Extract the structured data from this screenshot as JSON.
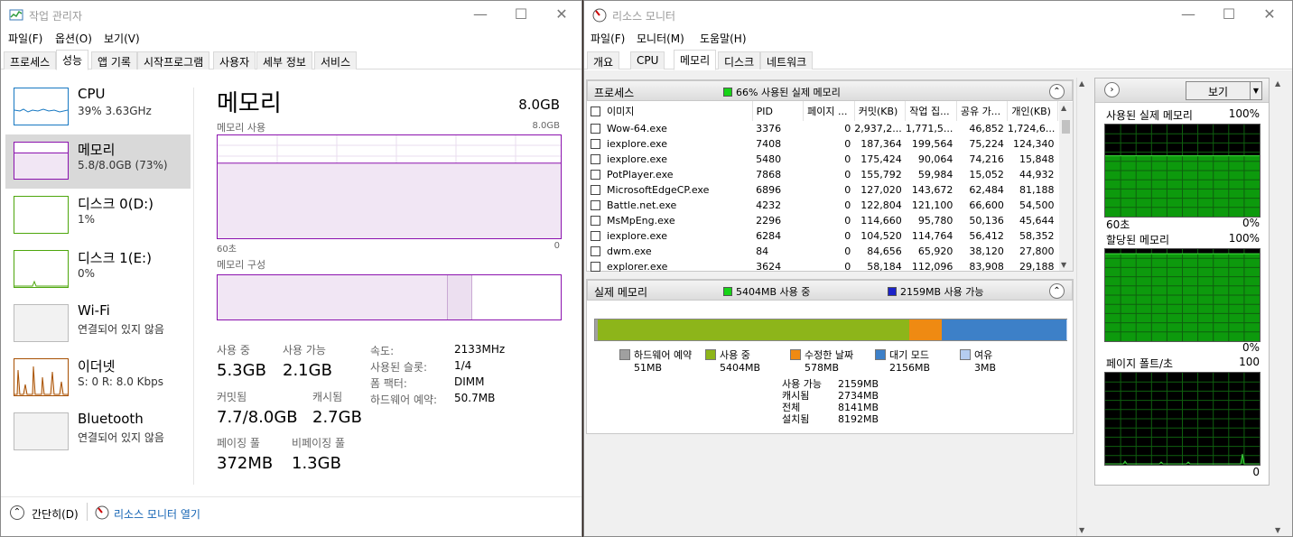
{
  "task_manager": {
    "title": "작업 관리자",
    "menu": [
      "파일(F)",
      "옵션(O)",
      "보기(V)"
    ],
    "tabs": [
      "프로세스",
      "성능",
      "앱 기록",
      "시작프로그램",
      "사용자",
      "세부 정보",
      "서비스"
    ],
    "active_tab": "성능",
    "left_items": [
      {
        "title": "CPU",
        "sub": "39% 3.63GHz"
      },
      {
        "title": "메모리",
        "sub": "5.8/8.0GB (73%)"
      },
      {
        "title": "디스크 0(D:)",
        "sub": "1%"
      },
      {
        "title": "디스크 1(E:)",
        "sub": "0%"
      },
      {
        "title": "Wi-Fi",
        "sub": "연결되어 있지 않음"
      },
      {
        "title": "이더넷",
        "sub": "S: 0  R: 8.0 Kbps"
      },
      {
        "title": "Bluetooth",
        "sub": "연결되어 있지 않음"
      }
    ],
    "memory": {
      "heading": "메모리",
      "total": "8.0GB",
      "usage_label": "메모리 사용",
      "usage_max": "8.0GB",
      "x_left": "60초",
      "x_right": "0",
      "composition_label": "메모리 구성",
      "used_pct": 0.73,
      "stats": [
        {
          "label": "사용 중",
          "value": "5.3GB"
        },
        {
          "label": "사용 가능",
          "value": "2.1GB"
        },
        {
          "label": "커밋됨",
          "value": "7.7/8.0GB"
        },
        {
          "label": "캐시됨",
          "value": "2.7GB"
        },
        {
          "label": "페이징 풀",
          "value": "372MB"
        },
        {
          "label": "비페이징 풀",
          "value": "1.3GB"
        }
      ],
      "specs": [
        {
          "label": "속도:",
          "value": "2133MHz"
        },
        {
          "label": "사용된 슬롯:",
          "value": "1/4"
        },
        {
          "label": "폼 팩터:",
          "value": "DIMM"
        },
        {
          "label": "하드웨어 예약:",
          "value": "50.7MB"
        }
      ]
    },
    "footer": {
      "fewer": "간단히(D)",
      "resmon": "리소스 모니터 열기"
    }
  },
  "resource_monitor": {
    "title": "리소스 모니터",
    "menu": [
      "파일(F)",
      "모니터(M)",
      "도움말(H)"
    ],
    "tabs": [
      "개요",
      "CPU",
      "메모리",
      "디스크",
      "네트워크"
    ],
    "active_tab": "메모리",
    "process_section": {
      "title": "프로세스",
      "meter": "66% 사용된 실제 메모리",
      "columns": [
        "이미지",
        "PID",
        "페이지 ...",
        "커밋(KB)",
        "작업 집...",
        "공유 가...",
        "개인(KB)"
      ],
      "rows": [
        [
          "Wow-64.exe",
          "3376",
          "0",
          "2,937,2...",
          "1,771,5...",
          "46,852",
          "1,724,6..."
        ],
        [
          "iexplore.exe",
          "7408",
          "0",
          "187,364",
          "199,564",
          "75,224",
          "124,340"
        ],
        [
          "iexplore.exe",
          "5480",
          "0",
          "175,424",
          "90,064",
          "74,216",
          "15,848"
        ],
        [
          "PotPlayer.exe",
          "7868",
          "0",
          "155,792",
          "59,984",
          "15,052",
          "44,932"
        ],
        [
          "MicrosoftEdgeCP.exe",
          "6896",
          "0",
          "127,020",
          "143,672",
          "62,484",
          "81,188"
        ],
        [
          "Battle.net.exe",
          "4232",
          "0",
          "122,804",
          "121,100",
          "66,600",
          "54,500"
        ],
        [
          "MsMpEng.exe",
          "2296",
          "0",
          "114,660",
          "95,780",
          "50,136",
          "45,644"
        ],
        [
          "iexplore.exe",
          "6284",
          "0",
          "104,520",
          "114,764",
          "56,412",
          "58,352"
        ],
        [
          "dwm.exe",
          "84",
          "0",
          "84,656",
          "65,920",
          "38,120",
          "27,800"
        ],
        [
          "explorer.exe",
          "3624",
          "0",
          "58,184",
          "112,096",
          "83,908",
          "29,188"
        ]
      ]
    },
    "physical_section": {
      "title": "실제 메모리",
      "in_use": "5404MB 사용 중",
      "available": "2159MB 사용 가능",
      "bar": [
        {
          "name": "hardware",
          "mb": 51,
          "color": "#a0a0a0"
        },
        {
          "name": "inuse",
          "mb": 5404,
          "color": "#8db51a"
        },
        {
          "name": "modified",
          "mb": 578,
          "color": "#ef8a12"
        },
        {
          "name": "standby",
          "mb": 2156,
          "color": "#3d80c8"
        },
        {
          "name": "free",
          "mb": 3,
          "color": "#b5cdf0"
        }
      ],
      "legend": [
        {
          "label": "하드웨어 예약",
          "value": "51MB",
          "color": "#a0a0a0"
        },
        {
          "label": "사용 중",
          "value": "5404MB",
          "color": "#8db51a"
        },
        {
          "label": "수정한 날짜",
          "value": "578MB",
          "color": "#ef8a12"
        },
        {
          "label": "대기 모드",
          "value": "2156MB",
          "color": "#3d80c8"
        },
        {
          "label": "여유",
          "value": "3MB",
          "color": "#b5cdf0"
        }
      ],
      "summary": [
        {
          "label": "사용 가능",
          "value": "2159MB"
        },
        {
          "label": "캐시됨",
          "value": "2734MB"
        },
        {
          "label": "전체",
          "value": "8141MB"
        },
        {
          "label": "설치됨",
          "value": "8192MB"
        }
      ]
    },
    "side": {
      "view_button": "보기",
      "graphs": [
        {
          "title": "사용된 실제 메모리",
          "max": "100%",
          "left": "60초",
          "min": "0%",
          "fill_pct": 0.66
        },
        {
          "title": "할당된 메모리",
          "max": "100%",
          "left": "",
          "min": "0%",
          "fill_pct": 0.95
        },
        {
          "title": "페이지 폴트/초",
          "max": "100",
          "left": "",
          "min": "0",
          "fill_pct": 0.0
        }
      ]
    }
  }
}
